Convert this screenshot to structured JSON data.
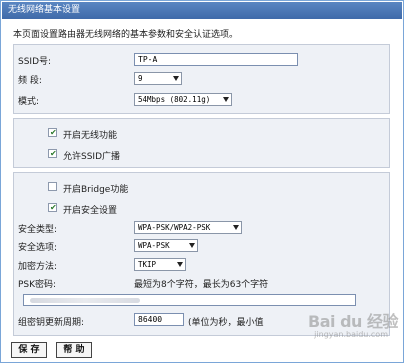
{
  "window": {
    "title": "无线网络基本设置"
  },
  "description": "本页面设置路由器无线网络的基本参数和安全认证选项。",
  "basic": {
    "ssid_label": "SSID号:",
    "ssid_value": "TP-A",
    "channel_label": "频 段:",
    "channel_value": "9",
    "mode_label": "模式:",
    "mode_value": "54Mbps (802.11g)"
  },
  "options": {
    "enable_wireless": "开启无线功能",
    "allow_ssid_broadcast": "允许SSID广播",
    "enable_bridge": "开启Bridge功能",
    "enable_security": "开启安全设置",
    "enable_wireless_checked": true,
    "allow_ssid_broadcast_checked": true,
    "enable_bridge_checked": false,
    "enable_security_checked": true
  },
  "security": {
    "type_label": "安全类型:",
    "type_value": "WPA-PSK/WPA2-PSK",
    "option_label": "安全选项:",
    "option_value": "WPA-PSK",
    "encryption_label": "加密方法:",
    "encryption_value": "TKIP",
    "psk_label": "PSK密码:",
    "psk_hint": "最短为8个字符，最长为63个字符",
    "renew_label": "组密钥更新周期:",
    "renew_value": "86400",
    "renew_hint": "(单位为秒，最小值"
  },
  "buttons": {
    "save": "保 存",
    "help": "帮 助"
  },
  "watermark": {
    "main": "Bai du 经验",
    "sub": "jingyan.baidu.com"
  }
}
